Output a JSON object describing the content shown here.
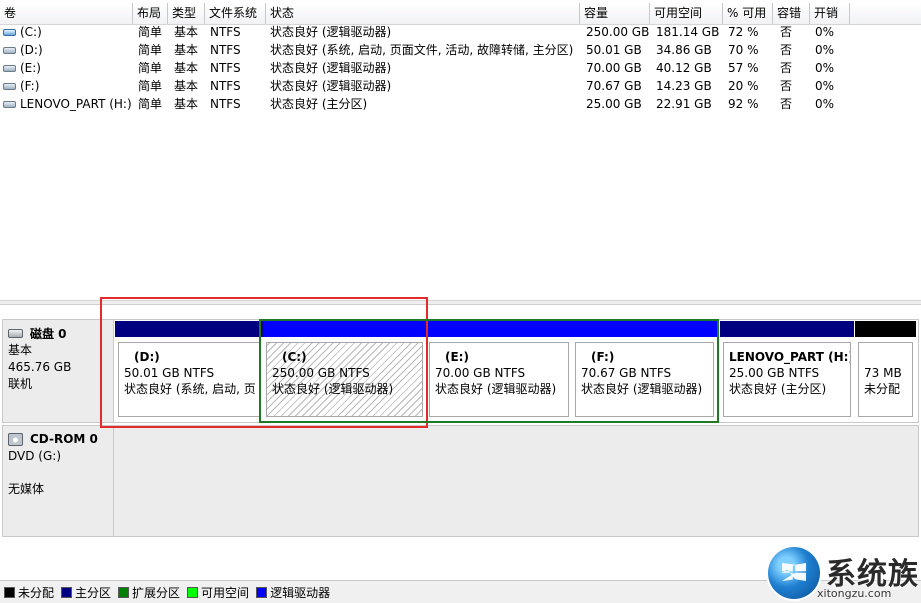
{
  "columns": [
    "卷",
    "布局",
    "类型",
    "文件系统",
    "状态",
    "容量",
    "可用空间",
    "% 可用",
    "容错",
    "开销"
  ],
  "volumes": [
    {
      "name": "(C:)",
      "layout": "简单",
      "type": "基本",
      "fs": "NTFS",
      "status": "状态良好 (逻辑驱动器)",
      "capacity": "250.00 GB",
      "free": "181.14 GB",
      "pct": "72 %",
      "fault": "否",
      "overhead": "0%",
      "icon": "system-volume-icon"
    },
    {
      "name": "(D:)",
      "layout": "简单",
      "type": "基本",
      "fs": "NTFS",
      "status": "状态良好 (系统, 启动, 页面文件, 活动, 故障转储, 主分区)",
      "capacity": "50.01 GB",
      "free": "34.86 GB",
      "pct": "70 %",
      "fault": "否",
      "overhead": "0%",
      "icon": "volume-icon"
    },
    {
      "name": "(E:)",
      "layout": "简单",
      "type": "基本",
      "fs": "NTFS",
      "status": "状态良好 (逻辑驱动器)",
      "capacity": "70.00 GB",
      "free": "40.12 GB",
      "pct": "57 %",
      "fault": "否",
      "overhead": "0%",
      "icon": "volume-icon"
    },
    {
      "name": "(F:)",
      "layout": "简单",
      "type": "基本",
      "fs": "NTFS",
      "status": "状态良好 (逻辑驱动器)",
      "capacity": "70.67 GB",
      "free": "14.23 GB",
      "pct": "20 %",
      "fault": "否",
      "overhead": "0%",
      "icon": "volume-icon"
    },
    {
      "name": "LENOVO_PART (H:)",
      "layout": "简单",
      "type": "基本",
      "fs": "NTFS",
      "status": "状态良好 (主分区)",
      "capacity": "25.00 GB",
      "free": "22.91 GB",
      "pct": "92 %",
      "fault": "否",
      "overhead": "0%",
      "icon": "volume-icon"
    }
  ],
  "disk0": {
    "title": "磁盘 0",
    "kind": "基本",
    "size": "465.76 GB",
    "state": "联机",
    "partitions": [
      {
        "name": "(D:)",
        "size": "50.01 GB NTFS",
        "status": "状态良好 (系统, 启动, 页",
        "bar_color": "#000080"
      },
      {
        "name": "(C:)",
        "size": "250.00 GB NTFS",
        "status": "状态良好 (逻辑驱动器)",
        "bar_color": "#0000ff"
      },
      {
        "name": "(E:)",
        "size": "70.00 GB NTFS",
        "status": "状态良好 (逻辑驱动器)",
        "bar_color": "#0000ff"
      },
      {
        "name": "(F:)",
        "size": "70.67 GB NTFS",
        "status": "状态良好 (逻辑驱动器)",
        "bar_color": "#0000ff"
      },
      {
        "name": "LENOVO_PART  (H:)",
        "size": "25.00 GB NTFS",
        "status": "状态良好 (主分区)",
        "bar_color": "#000080"
      },
      {
        "name": "",
        "size": "73 MB",
        "status": "未分配",
        "bar_color": "#000000"
      }
    ]
  },
  "cdrom0": {
    "title": "CD-ROM 0",
    "drive": "DVD (G:)",
    "media": "无媒体"
  },
  "legend": [
    {
      "label": "未分配",
      "color": "#000000"
    },
    {
      "label": "主分区",
      "color": "#000080"
    },
    {
      "label": "扩展分区",
      "color": "#008000"
    },
    {
      "label": "可用空间",
      "color": "#00ff00"
    },
    {
      "label": "逻辑驱动器",
      "color": "#0000ff"
    }
  ],
  "watermark": {
    "brand": "系统族",
    "url": "xitongzu.com"
  }
}
